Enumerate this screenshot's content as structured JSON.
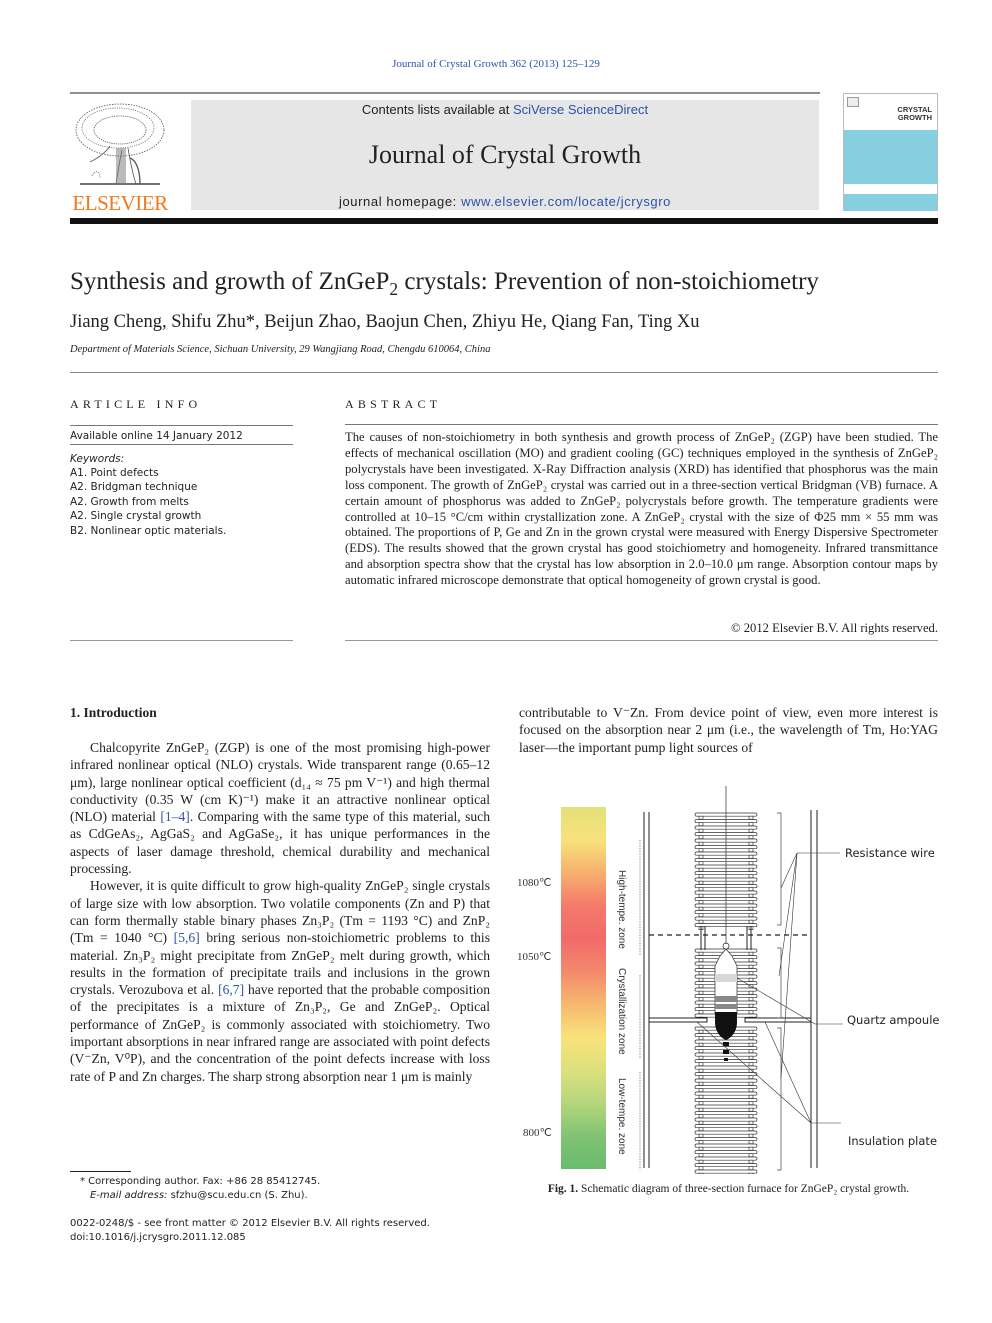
{
  "running_head": "Journal of Crystal Growth 362 (2013) 125–129",
  "masthead": {
    "contents_prefix": "Contents lists available at ",
    "contents_link": "SciVerse ScienceDirect",
    "journal_name": "Journal of Crystal Growth",
    "homepage_prefix": "journal homepage: ",
    "homepage_link": "www.elsevier.com/locate/jcrysgro",
    "publisher": "ELSEVIER",
    "cover_title_line1": "CRYSTAL",
    "cover_title_line2": "GROWTH",
    "cover_color": "#85cfe0",
    "publisher_color": "#f07a1b",
    "link_color": "#2c53a8"
  },
  "article": {
    "title_pre": "Synthesis and growth of ZnGeP",
    "title_sub": "2",
    "title_post": " crystals: Prevention of non-stoichiometry",
    "authors": "Jiang Cheng, Shifu Zhu*, Beijun Zhao, Baojun Chen, Zhiyu He, Qiang Fan, Ting Xu",
    "affiliation": "Department of Materials Science, Sichuan University, 29 Wangjiang Road, Chengdu 610064, China"
  },
  "article_info": {
    "heading": "ARTICLE INFO",
    "available_online": "Available online 14 January 2012",
    "keywords_label": "Keywords:",
    "keywords": [
      "A1. Point defects",
      "A2. Bridgman technique",
      "A2. Growth from melts",
      "A2. Single crystal growth",
      "B2. Nonlinear optic materials."
    ]
  },
  "abstract": {
    "heading": "ABSTRACT",
    "text": "The causes of non-stoichiometry in both synthesis and growth process of ZnGeP₂ (ZGP) have been studied. The effects of mechanical oscillation (MO) and gradient cooling (GC) techniques employed in the synthesis of ZnGeP₂ polycrystals have been investigated. X-Ray Diffraction analysis (XRD) has identified that phosphorus was the main loss component. The growth of ZnGeP₂ crystal was carried out in a three-section vertical Bridgman (VB) furnace. A certain amount of phosphorus was added to ZnGeP₂ polycrystals before growth. The temperature gradients were controlled at 10–15 °C/cm within crystallization zone. A ZnGeP₂ crystal with the size of Φ25 mm × 55 mm was obtained. The proportions of P, Ge and Zn in the grown crystal were measured with Energy Dispersive Spectrometer (EDS). The results showed that the grown crystal has good stoichiometry and homogeneity. Infrared transmittance and absorption spectra show that the crystal has low absorption in 2.0–10.0 μm range. Absorption contour maps by automatic infrared microscope demonstrate that optical homogeneity of grown crystal is good.",
    "copyright": "© 2012 Elsevier B.V. All rights reserved."
  },
  "introduction": {
    "heading": "1.  Introduction",
    "p1": [
      "Chalcopyrite ZnGeP₂ (ZGP) is one of the most promising high-power infrared nonlinear optical (NLO) crystals. Wide transparent range (0.65–12 μm), large nonlinear optical coefficient (d₁₄ ≈ 75 pm V⁻¹) and high thermal conductivity (0.35 W (cm K)⁻¹) make it an attractive nonlinear optical (NLO) material ",
      "[1–4]",
      ". Comparing with the same type of this material, such as CdGeAs₂, AgGaS₂ and AgGaSe₂, it has unique performances in the aspects of laser damage threshold, chemical durability and mechanical processing."
    ],
    "p2": [
      "However, it is quite difficult to grow high-quality ZnGeP₂ single crystals of large size with low absorption. Two volatile components (Zn and P) that can form thermally stable binary phases Zn₃P₂ (Tm = 1193 °C) and ZnP₂ (Tm = 1040 °C) ",
      "[5,6]",
      " bring serious non-stoichiometric problems to this material. Zn₃P₂ might precipitate from ZnGeP₂ melt during growth, which results in the formation of precipitate trails and inclusions in the grown crystals. Verozubova et al. ",
      "[6,7]",
      " have reported that the probable composition of the precipitates is a mixture of Zn₃P₂, Ge and ZnGeP₂. Optical performance of ZnGeP₂ is commonly associated with stoichiometry. Two important absorptions in near infrared range are associated with point defects (V⁻Zn, V⁰P), and the concentration of the point defects increase with loss rate of P and Zn charges. The sharp strong absorption near 1 μm is mainly"
    ],
    "right_col": "contributable to V⁻Zn. From device point of view, even more interest is focused on the absorption near 2 μm (i.e., the wavelength of Tm, Ho:YAG laser—the important pump light sources of"
  },
  "footnotes": {
    "corresponding": "* Corresponding author. Fax: +86 28 85412745.",
    "email_label": "E-mail address:",
    "email": " sfzhu@scu.edu.cn (S. Zhu).",
    "issn": "0022-0248/$ - see front matter © 2012 Elsevier B.V. All rights reserved.",
    "doi": "doi:10.1016/j.jcrysgro.2011.12.085"
  },
  "figure": {
    "caption_label": "Fig. 1.",
    "caption_text": " Schematic diagram of three-section furnace for ZnGeP₂ crystal growth.",
    "temperature_labels": [
      "1080℃",
      "1050℃",
      "800℃"
    ],
    "zone_labels": [
      "High-tempe. zone",
      "Crystallization zone",
      "Low-tempe. zone"
    ],
    "callouts": [
      "Resistance wire",
      "Quartz ampoule",
      "Insulation plate"
    ],
    "gradient_colors": [
      "#e3e07a",
      "#f8e27c",
      "#f6b06e",
      "#f47a6a",
      "#f26a6a",
      "#f4886c",
      "#f7b86f",
      "#f9e27b",
      "#dde07e",
      "#b5d67c",
      "#80c373",
      "#6bbb6f"
    ]
  }
}
